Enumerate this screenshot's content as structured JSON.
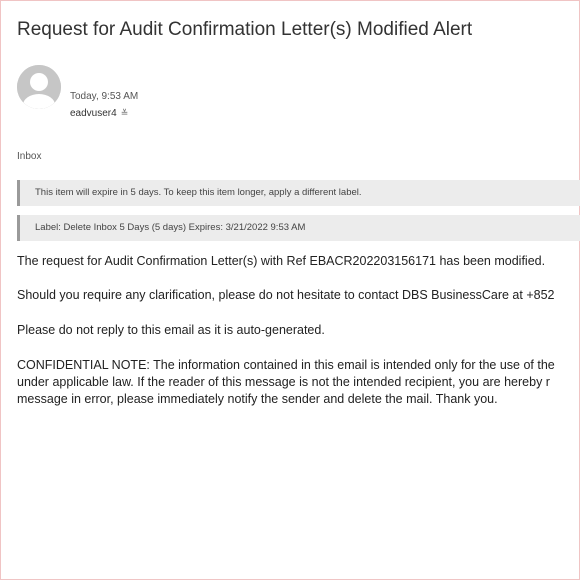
{
  "email": {
    "subject": "Request for Audit Confirmation Letter(s) Modified Alert",
    "time": "Today, 9:53 AM",
    "sender": "eadvuser4",
    "expand_glyph": "≚",
    "folder": "Inbox",
    "retention_notice": "This item will expire in 5 days. To keep this item longer, apply a different label.",
    "label_notice": "Label: Delete Inbox 5 Days (5 days) Expires: 3/21/2022 9:53 AM",
    "body": {
      "p1": "The request for Audit Confirmation Letter(s) with Ref EBACR202203156171 has been modified.",
      "p2": "Should you require any clarification, please do not hesitate to contact DBS BusinessCare at +852",
      "p3": "Please do not reply to this email as it is auto-generated.",
      "p4_line1": "CONFIDENTIAL NOTE: The information contained in this email is intended only for the use of the",
      "p4_line2": "under applicable law. If the reader of this message is not the intended recipient, you are hereby r",
      "p4_line3": "message in error, please immediately notify the sender and delete the mail. Thank you."
    }
  }
}
